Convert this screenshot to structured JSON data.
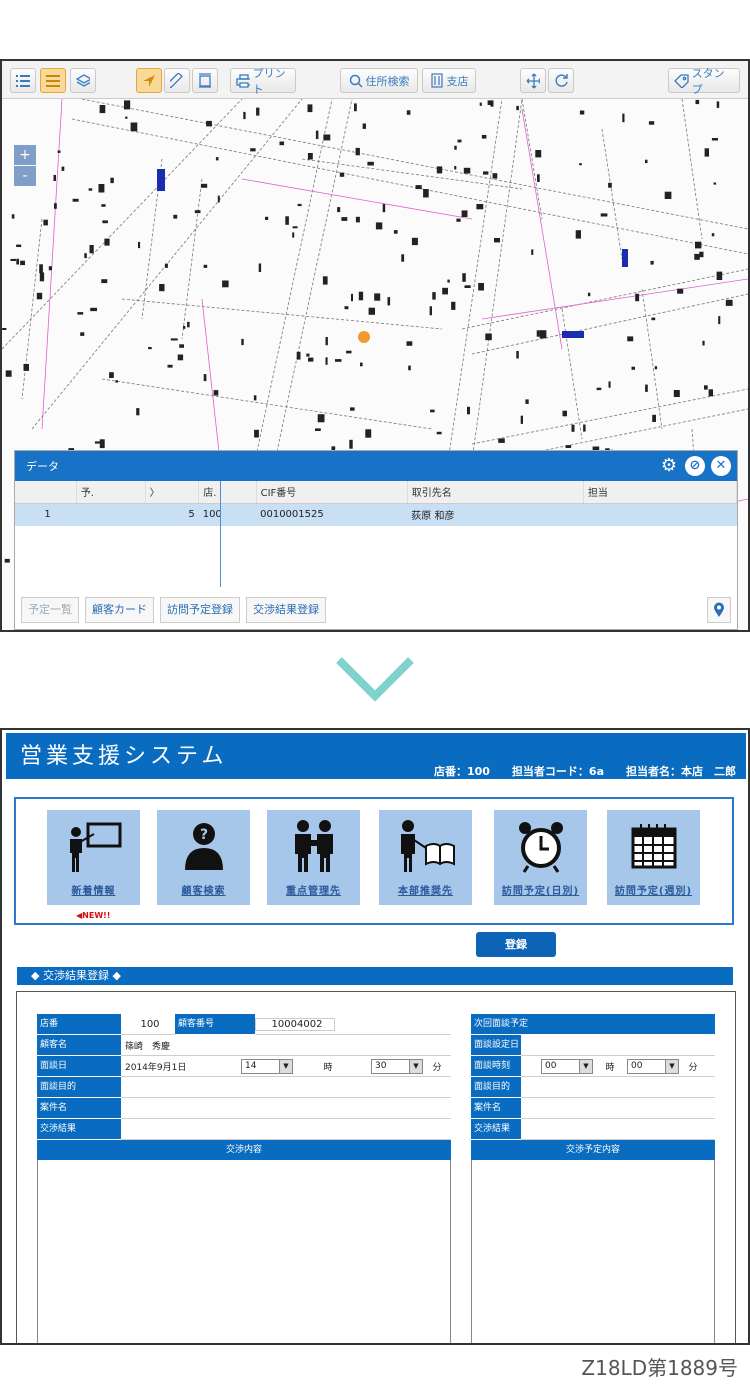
{
  "toolbar": {
    "print_label": "プリント",
    "address_search_label": "住所検索",
    "branch_label": "支店",
    "stamp_label": "スタンプ"
  },
  "zoom": {
    "plus": "+",
    "minus": "-"
  },
  "panel": {
    "title": "データ",
    "columns": [
      "",
      "予.",
      "〉",
      "店.",
      "CIF番号",
      "取引先名",
      "担当"
    ],
    "rows": [
      {
        "no": "1",
        "yo": "",
        "arrow": "5",
        "shop": "100",
        "cif": "0010001525",
        "name": "荻原 和彦",
        "tanto": ""
      }
    ],
    "buttons": {
      "schedule_list": "予定一覧",
      "customer_card": "顧客カード",
      "visit_plan": "訪問予定登録",
      "negotiation_result": "交渉結果登録"
    }
  },
  "system": {
    "title": "営業支援システム",
    "shop": "店番：100",
    "staff_code": "担当者コード：6a",
    "staff_name": "担当者名：本店　二郎"
  },
  "menu": [
    {
      "label": "新着情報",
      "icon": "presentation-icon"
    },
    {
      "label": "顧客検索",
      "icon": "customer-search-icon"
    },
    {
      "label": "重点管理先",
      "icon": "handshake-icon"
    },
    {
      "label": "本部推奨先",
      "icon": "recommend-book-icon"
    },
    {
      "label": "訪問予定(日別)",
      "icon": "alarm-clock-icon"
    },
    {
      "label": "訪問予定(週別)",
      "icon": "calendar-icon"
    }
  ],
  "new_badge": "◀NEW!!",
  "register_button": "登録",
  "section_title": "◆ 交渉結果登録 ◆",
  "form_left": {
    "shop_label": "店番",
    "shop_value": "100",
    "customer_no_label": "顧客番号",
    "customer_no_value": "10004002",
    "customer_name_label": "顧客名",
    "customer_name_value": "篠崎　秀慶",
    "date_label": "面談日",
    "date_value": "2014年9月1日",
    "hour_value": "14",
    "hour_unit": "時",
    "minute_value": "30",
    "minute_unit": "分",
    "purpose_label": "面談目的",
    "case_label": "案件名",
    "result_label": "交渉結果",
    "content_head": "交渉内容"
  },
  "form_right": {
    "next_label": "次回面談予定",
    "next_date_label": "面談設定日",
    "time_label": "面談時刻",
    "hour_value": "00",
    "hour_unit": "時",
    "minute_value": "00",
    "minute_unit": "分",
    "purpose_label": "面談目的",
    "case_label": "案件名",
    "result_label": "交渉結果",
    "content_head": "交渉予定内容"
  },
  "footer_code": "Z18LD第1889号",
  "colors": {
    "brand_blue": "#0a6cc0",
    "tile_blue": "#a6c6ea",
    "chevron": "#7fd3cc"
  }
}
